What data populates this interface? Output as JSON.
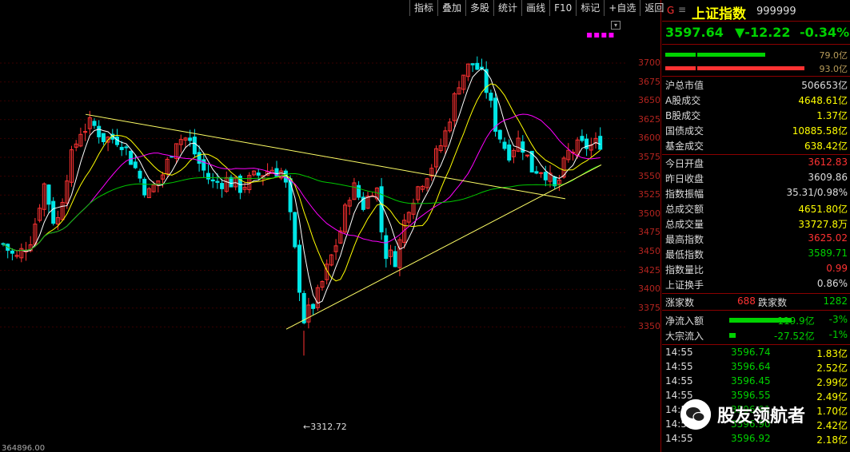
{
  "toolbar": [
    "指标",
    "叠加",
    "多股",
    "统计",
    "画线",
    "F10",
    "标记",
    "+自选",
    "返回"
  ],
  "chart": {
    "y_labels": [
      "3700",
      "3675",
      "3650",
      "3625",
      "3600",
      "3575",
      "3550",
      "3525",
      "3500",
      "3475",
      "3450",
      "3425",
      "3400",
      "3375",
      "3350"
    ],
    "low_label": "←3312.72",
    "bottom_left_value": "364896.00"
  },
  "stock": {
    "g_icon": "G",
    "menu_icon": "≡",
    "name": "上证指数",
    "code": "999999",
    "price": "3597.64",
    "change": "▼-12.22",
    "change_pct": "-0.34%"
  },
  "bars": {
    "top_pct": "79.0亿",
    "bottom_pct": "93.0亿"
  },
  "market": [
    {
      "label": "沪总市值",
      "value": "506653亿",
      "cls": "white"
    },
    {
      "label": "A股成交",
      "value": "4648.61亿",
      "cls": "yellow"
    },
    {
      "label": "B股成交",
      "value": "1.37亿",
      "cls": "yellow"
    },
    {
      "label": "国债成交",
      "value": "10885.58亿",
      "cls": "yellow"
    },
    {
      "label": "基金成交",
      "value": "638.42亿",
      "cls": "yellow"
    }
  ],
  "stats": [
    {
      "label": "今日开盘",
      "value": "3612.83",
      "cls": "red"
    },
    {
      "label": "昨日收盘",
      "value": "3609.86",
      "cls": "white"
    },
    {
      "label": "指数振幅",
      "value": "35.31/0.98%",
      "cls": "white"
    },
    {
      "label": "总成交额",
      "value": "4651.80亿",
      "cls": "yellow"
    },
    {
      "label": "总成交量",
      "value": "33727.8万",
      "cls": "yellow"
    },
    {
      "label": "最高指数",
      "value": "3625.02",
      "cls": "red"
    },
    {
      "label": "最低指数",
      "value": "3589.71",
      "cls": "green"
    },
    {
      "label": "指数量比",
      "value": "0.99",
      "cls": "red"
    },
    {
      "label": "上证换手",
      "value": "0.86%",
      "cls": "white"
    }
  ],
  "breadth": {
    "up_label": "涨家数",
    "up_value": "688",
    "down_label": "跌家数",
    "down_value": "1282"
  },
  "flows": [
    {
      "label": "净流入额",
      "amount": "-119.9亿",
      "pct": "-3%",
      "bar": 78
    },
    {
      "label": "大宗流入",
      "amount": "-27.52亿",
      "pct": "-1%",
      "bar": 8
    }
  ],
  "ticks": [
    {
      "time": "14:55",
      "price": "3596.74",
      "vol": "1.83亿"
    },
    {
      "time": "14:55",
      "price": "3596.64",
      "vol": "2.52亿"
    },
    {
      "time": "14:55",
      "price": "3596.45",
      "vol": "2.99亿"
    },
    {
      "time": "14:55",
      "price": "3596.55",
      "vol": "2.49亿"
    },
    {
      "time": "14:55",
      "price": "3596.91",
      "vol": "1.70亿"
    },
    {
      "time": "14:55",
      "price": "3596.90",
      "vol": "2.42亿"
    },
    {
      "time": "14:55",
      "price": "3596.92",
      "vol": "2.18亿"
    }
  ],
  "watermark": "股友领航者",
  "colors": {
    "up": "#ff3232",
    "down": "#00e6e6",
    "ma5": "#ffffff",
    "ma10": "#ffff00",
    "ma20": "#ff00ff",
    "ma60": "#00c800",
    "trendline": "#ffff66"
  }
}
